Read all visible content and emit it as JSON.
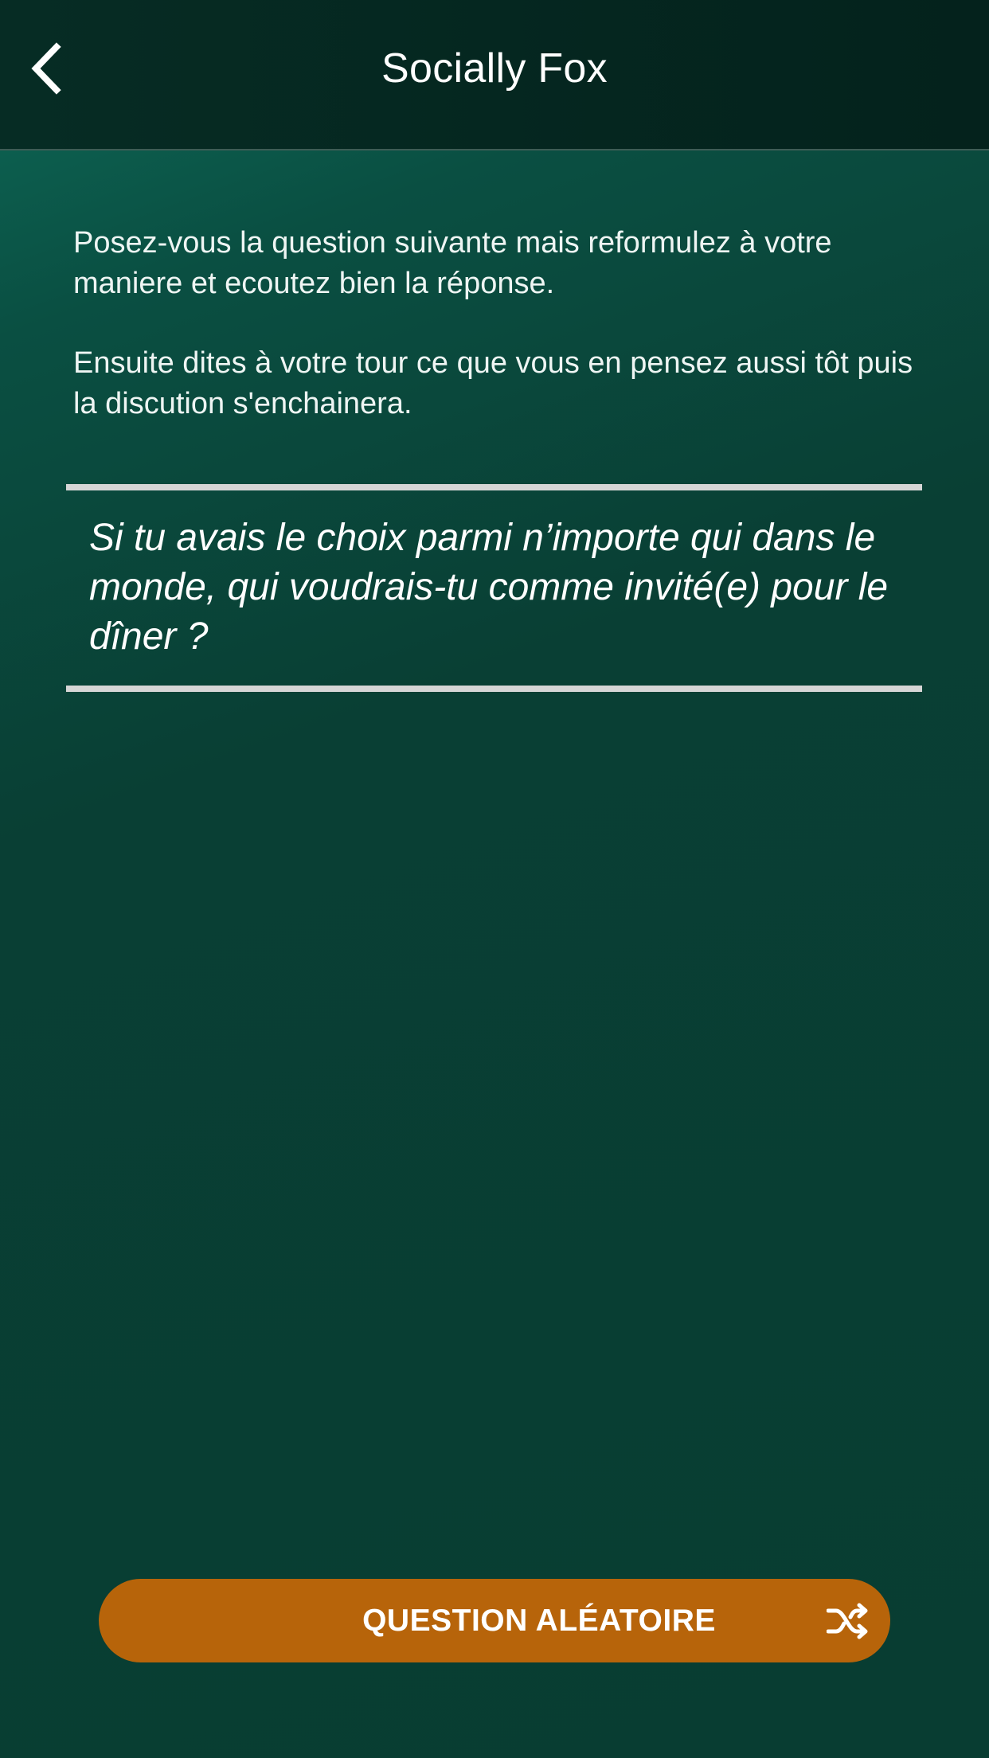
{
  "header": {
    "title": "Socially Fox",
    "back_icon": "chevron-left-icon"
  },
  "instructions": {
    "paragraph_1": "Posez-vous la question suivante mais reformulez à votre maniere et ecoutez bien la réponse.",
    "paragraph_2": "Ensuite dites à votre tour ce que vous en pensez aussi tôt puis la discution s'enchainera."
  },
  "question": {
    "text": "Si tu avais le choix parmi n’importe qui dans le monde, qui voudrais-tu comme invité(e) pour le dîner ?"
  },
  "random_button": {
    "label": "QUESTION ALÉATOIRE",
    "icon": "shuffle-icon",
    "color": "#b7640a"
  },
  "colors": {
    "navbar": "#04221c",
    "background_top": "#0e6a58",
    "background_bottom": "#083d32",
    "divider": "#d6d6d6"
  }
}
